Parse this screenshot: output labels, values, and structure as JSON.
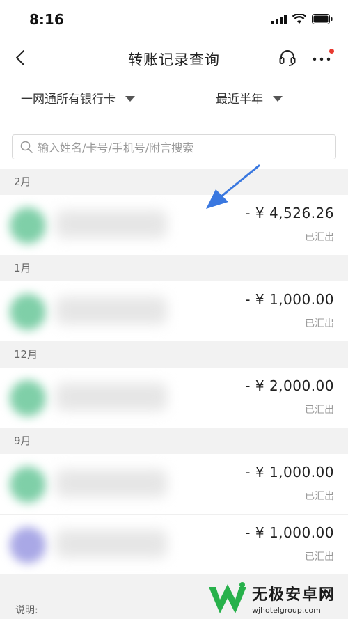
{
  "status_bar": {
    "time": "8:16"
  },
  "nav": {
    "title": "转账记录查询"
  },
  "filters": {
    "card": "一网通所有银行卡",
    "period": "最近半年"
  },
  "search": {
    "placeholder": "输入姓名/卡号/手机号/附言搜索"
  },
  "groups": [
    {
      "month": "2月",
      "records": [
        {
          "amount": "- ¥ 4,526.26",
          "status": "已汇出",
          "avatar_color": "#7fcfa8"
        }
      ]
    },
    {
      "month": "1月",
      "records": [
        {
          "amount": "- ¥ 1,000.00",
          "status": "已汇出",
          "avatar_color": "#7fcfa8"
        }
      ]
    },
    {
      "month": "12月",
      "records": [
        {
          "amount": "- ¥ 2,000.00",
          "status": "已汇出",
          "avatar_color": "#7fcfa8"
        }
      ]
    },
    {
      "month": "9月",
      "records": [
        {
          "amount": "- ¥ 1,000.00",
          "status": "已汇出",
          "avatar_color": "#7fcfa8"
        },
        {
          "amount": "- ¥ 1,000.00",
          "status": "已汇出",
          "avatar_color": "#a9a8e6"
        }
      ]
    }
  ],
  "note": "说明:",
  "watermark": {
    "title": "无极安卓网",
    "url": "wjhotelgroup.com"
  },
  "colors": {
    "accent_arrow": "#3a78e0",
    "logo_green": "#27b14b",
    "badge_red": "#e8392f"
  }
}
